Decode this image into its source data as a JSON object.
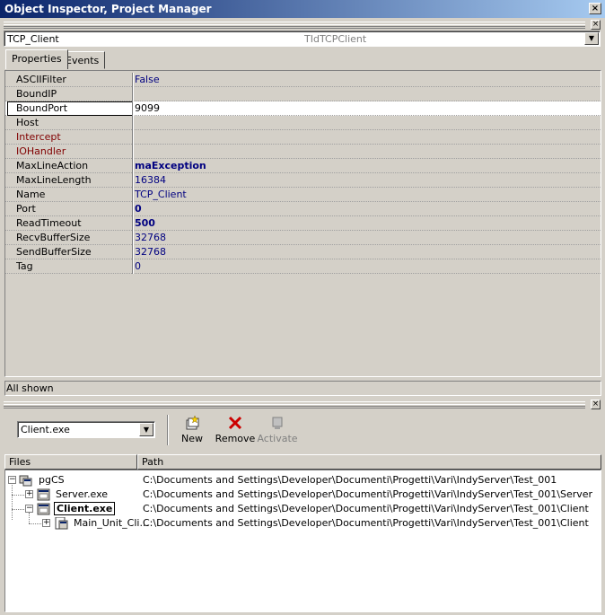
{
  "window": {
    "title": "Object Inspector, Project Manager",
    "close_glyph": "×"
  },
  "inspector": {
    "object_name": "TCP_Client",
    "object_type": "TIdTCPClient",
    "tabs": [
      {
        "label": "Properties"
      },
      {
        "label": "Events"
      }
    ],
    "properties": [
      {
        "name": "ASCIIFilter",
        "value": "False"
      },
      {
        "name": "BoundIP",
        "value": ""
      },
      {
        "name": "BoundPort",
        "value": "9099"
      },
      {
        "name": "Host",
        "value": ""
      },
      {
        "name": "Intercept",
        "value": ""
      },
      {
        "name": "IOHandler",
        "value": ""
      },
      {
        "name": "MaxLineAction",
        "value": "maException"
      },
      {
        "name": "MaxLineLength",
        "value": "16384"
      },
      {
        "name": "Name",
        "value": "TCP_Client"
      },
      {
        "name": "Port",
        "value": "0"
      },
      {
        "name": "ReadTimeout",
        "value": "500"
      },
      {
        "name": "RecvBufferSize",
        "value": "32768"
      },
      {
        "name": "SendBufferSize",
        "value": "32768"
      },
      {
        "name": "Tag",
        "value": "0"
      }
    ],
    "status": "All shown"
  },
  "project_manager": {
    "target_combo": "Client.exe",
    "toolbar": {
      "new_label": "New",
      "remove_label": "Remove",
      "activate_label": "Activate"
    },
    "columns": {
      "files": "Files",
      "path": "Path"
    },
    "tree": [
      {
        "label": "pgCS",
        "path": "C:\\Documents and Settings\\Developer\\Documenti\\Progetti\\Vari\\IndyServer\\Test_001",
        "expander": "−"
      },
      {
        "label": "Server.exe",
        "path": "C:\\Documents and Settings\\Developer\\Documenti\\Progetti\\Vari\\IndyServer\\Test_001\\Server",
        "expander": "+"
      },
      {
        "label": "Client.exe",
        "path": "C:\\Documents and Settings\\Developer\\Documenti\\Progetti\\Vari\\IndyServer\\Test_001\\Client",
        "expander": "−"
      },
      {
        "label": "Main_Unit_Cli...",
        "path": "C:\\Documents and Settings\\Developer\\Documenti\\Progetti\\Vari\\IndyServer\\Test_001\\Client",
        "expander": "+"
      }
    ]
  },
  "colors": {
    "value_blue": "#000080",
    "link_red": "#800000",
    "title_blue": "#0a246a",
    "remove_red": "#cc0000"
  }
}
